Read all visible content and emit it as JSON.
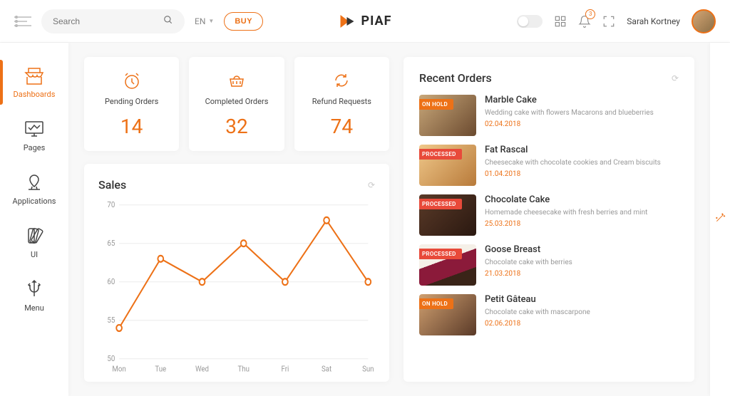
{
  "header": {
    "search_placeholder": "Search",
    "language": "EN",
    "buy_label": "BUY",
    "brand_name": "PIAF",
    "notifications_count": "3",
    "username": "Sarah Kortney"
  },
  "sidebar": {
    "items": [
      {
        "label": "Dashboards"
      },
      {
        "label": "Pages"
      },
      {
        "label": "Applications"
      },
      {
        "label": "UI"
      },
      {
        "label": "Menu"
      }
    ]
  },
  "stats": [
    {
      "label": "Pending Orders",
      "value": "14"
    },
    {
      "label": "Completed Orders",
      "value": "32"
    },
    {
      "label": "Refund Requests",
      "value": "74"
    }
  ],
  "sales": {
    "title": "Sales"
  },
  "chart_data": {
    "type": "line",
    "title": "Sales",
    "categories": [
      "Mon",
      "Tue",
      "Wed",
      "Thu",
      "Fri",
      "Sat",
      "Sun"
    ],
    "values": [
      54,
      63,
      60,
      65,
      60,
      68,
      60
    ],
    "ylabel": "",
    "xlabel": "",
    "ylim": [
      50,
      70
    ],
    "yticks": [
      50,
      55,
      60,
      65,
      70
    ]
  },
  "recent": {
    "title": "Recent Orders",
    "orders": [
      {
        "status": "ON HOLD",
        "status_class": "hold",
        "name": "Marble Cake",
        "desc": "Wedding cake with flowers Macarons and blueberries",
        "date": "02.04.2018"
      },
      {
        "status": "PROCESSED",
        "status_class": "processed",
        "name": "Fat Rascal",
        "desc": "Cheesecake with chocolate cookies and Cream biscuits",
        "date": "01.04.2018"
      },
      {
        "status": "PROCESSED",
        "status_class": "processed",
        "name": "Chocolate Cake",
        "desc": "Homemade cheesecake with fresh berries and mint",
        "date": "25.03.2018"
      },
      {
        "status": "PROCESSED",
        "status_class": "processed",
        "name": "Goose Breast",
        "desc": "Chocolate cake with berries",
        "date": "21.03.2018"
      },
      {
        "status": "ON HOLD",
        "status_class": "hold",
        "name": "Petit Gâteau",
        "desc": "Chocolate cake with mascarpone",
        "date": "02.06.2018"
      }
    ]
  }
}
